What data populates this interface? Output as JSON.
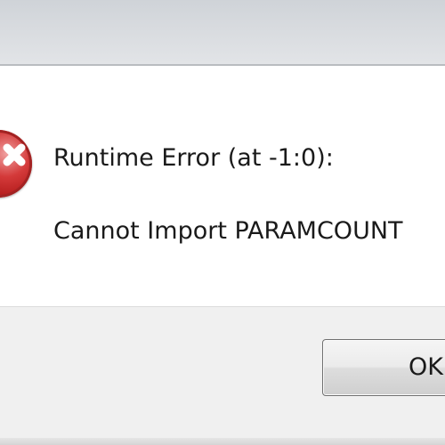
{
  "dialog": {
    "error_title": "Runtime Error (at -1:0):",
    "error_message": "Cannot Import PARAMCOUNT",
    "ok_label": "OK",
    "icon": "error-icon",
    "accent_color": "#c8201f"
  }
}
